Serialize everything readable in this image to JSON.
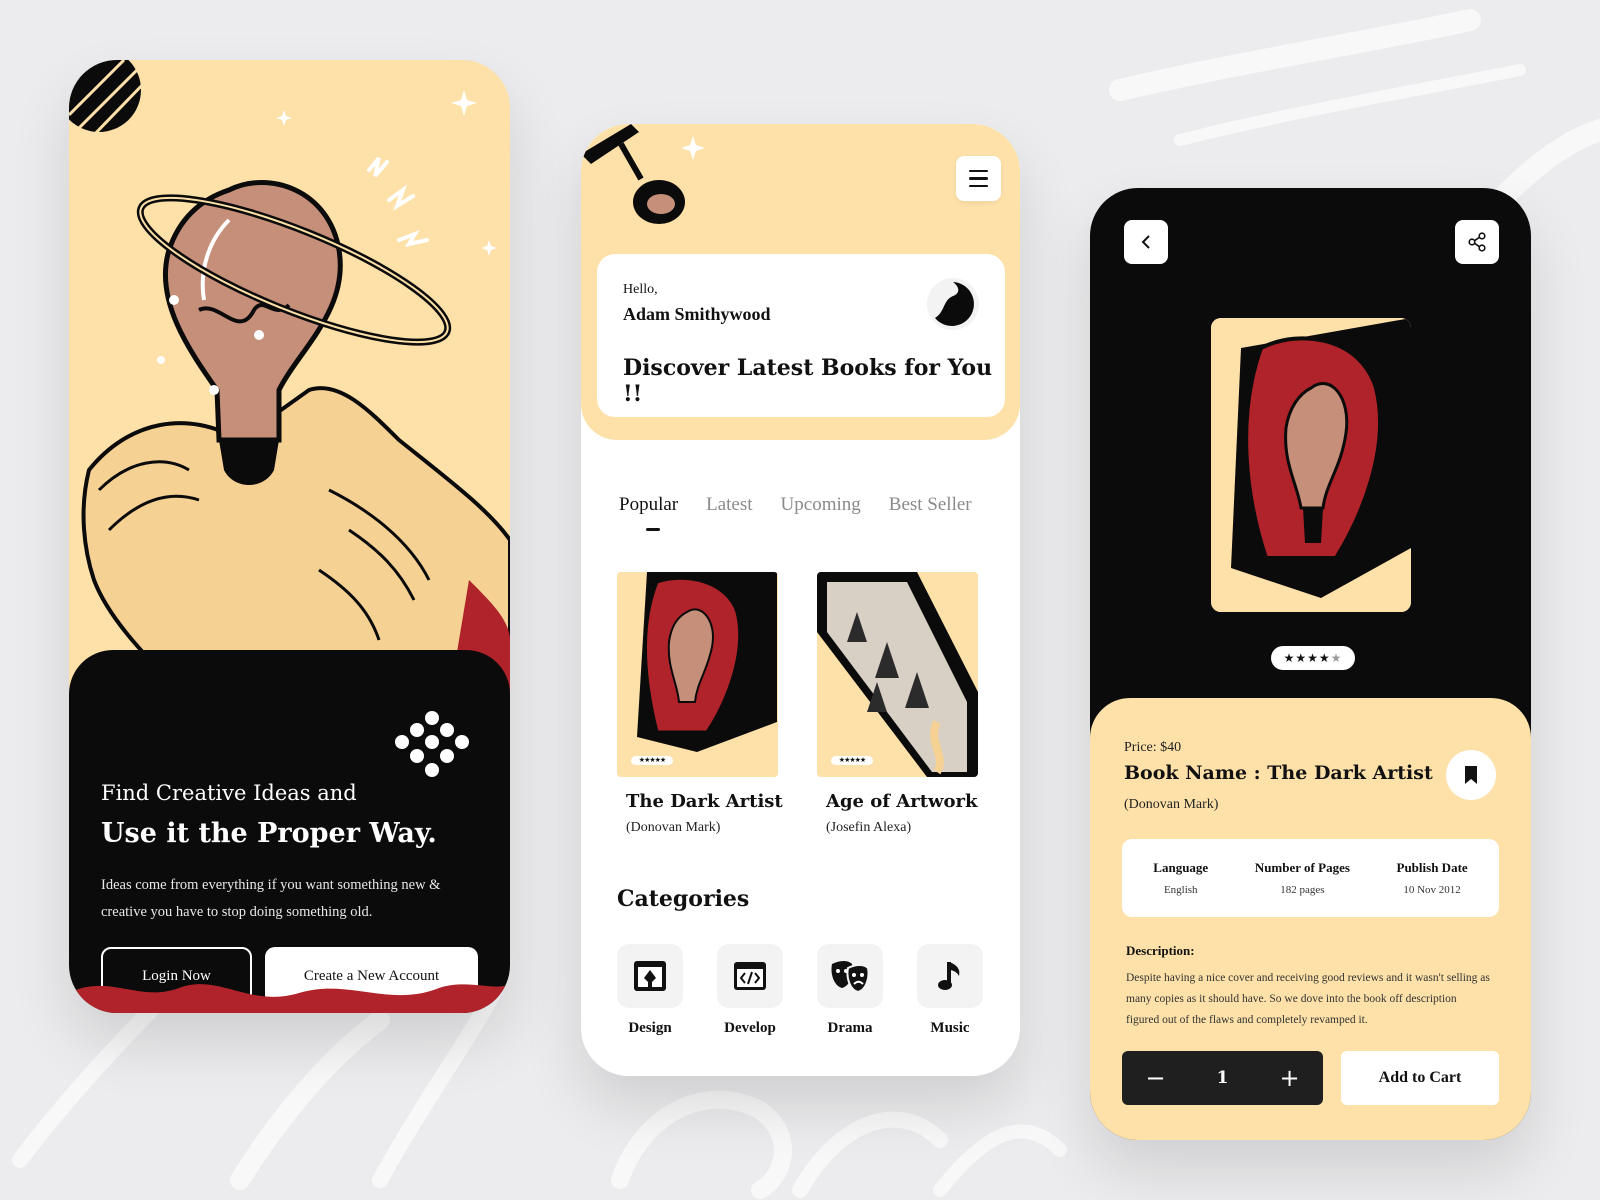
{
  "colors": {
    "accent_cream": "#fde1a9",
    "dark": "#0b0b0b",
    "red": "#b0232a",
    "background": "#ececee"
  },
  "onboarding": {
    "subheading": "Find Creative Ideas and",
    "headline": "Use it the Proper Way.",
    "body": "Ideas come from everything if you want something new & creative you have to stop doing something old.",
    "login_label": "Login Now",
    "create_label": "Create a New Account"
  },
  "home": {
    "greeting": "Hello,",
    "user_name": "Adam Smithywood",
    "tagline": "Discover Latest Books for You !!",
    "menu_icon": "hamburger-menu-icon",
    "tabs": [
      {
        "label": "Popular",
        "active": true
      },
      {
        "label": "Latest",
        "active": false
      },
      {
        "label": "Upcoming",
        "active": false
      },
      {
        "label": "Best Seller",
        "active": false
      }
    ],
    "books": [
      {
        "title": "The Dark Artist",
        "author": "(Donovan Mark)",
        "stars": "★★★★★"
      },
      {
        "title": "Age of Artwork",
        "author": "(Josefin Alexa)",
        "stars": "★★★★★"
      }
    ],
    "categories_title": "Categories",
    "categories": [
      {
        "label": "Design",
        "icon": "design-icon"
      },
      {
        "label": "Develop",
        "icon": "code-icon"
      },
      {
        "label": "Drama",
        "icon": "drama-masks-icon"
      },
      {
        "label": "Music",
        "icon": "music-note-icon"
      }
    ]
  },
  "detail": {
    "back_icon": "chevron-left-icon",
    "share_icon": "share-icon",
    "rating": 4,
    "rating_max": 5,
    "price": "Price: $40",
    "book_name": "Book Name : The Dark Artist",
    "author": "(Donovan Mark)",
    "meta": [
      {
        "key": "Language",
        "value": "English"
      },
      {
        "key": "Number of Pages",
        "value": "182 pages"
      },
      {
        "key": "Publish Date",
        "value": "10 Nov 2012"
      }
    ],
    "description_title": "Description:",
    "description": "Despite having a nice cover and receiving good reviews and it wasn't selling as many copies as it should have. So we dove into the book off description figured out of the flaws and completely revamped it.",
    "quantity": "1",
    "minus": "−",
    "plus": "+",
    "add_to_cart": "Add to Cart"
  }
}
